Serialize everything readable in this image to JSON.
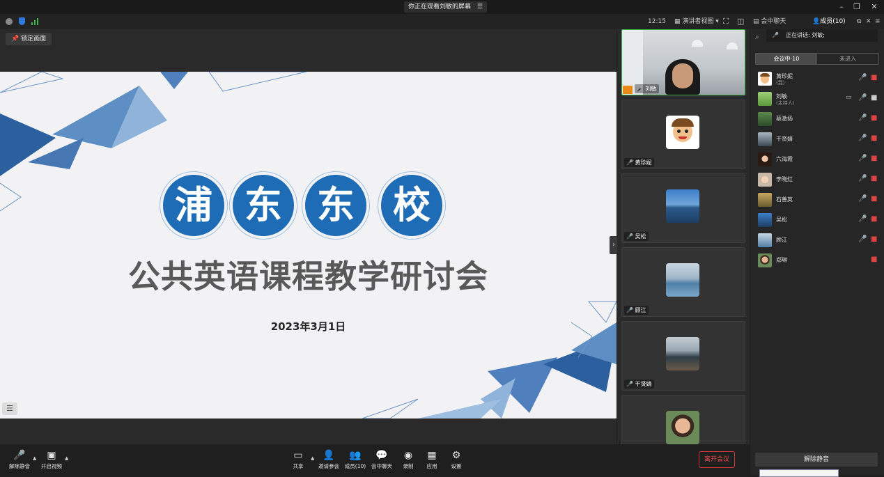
{
  "window": {
    "share_title": "你正在观看刘敏的屏幕",
    "share_icon": "menu-icon"
  },
  "topbar2": {
    "time": "12:15",
    "view_label": "演讲者视图",
    "chat_tab": "会中聊天",
    "members_tab": "成员(10)"
  },
  "stage": {
    "pin_label": "锁定画面"
  },
  "slide": {
    "circle_chars": [
      "浦",
      "东",
      "东",
      "校"
    ],
    "headline": "公共英语课程教学研讨会",
    "date": "2023年3月1日",
    "accent_color": "#1d6cb5"
  },
  "video_tiles": [
    {
      "name": "刘敏"
    },
    {
      "name": "黄珍妮"
    },
    {
      "name": "吴松"
    },
    {
      "name": "顾江"
    },
    {
      "name": "干贤婧"
    },
    {
      "name": ""
    }
  ],
  "panel": {
    "speaking": "正在讲话: 刘敏;",
    "tab_in_meeting": "会议中·10",
    "tab_not_joined": "未进入",
    "unmute_all": "解除静音",
    "participants": [
      {
        "name": "黄珍妮",
        "sub": "(我)"
      },
      {
        "name": "刘敏",
        "sub": "(主持人)"
      },
      {
        "name": "蔡激扬",
        "sub": ""
      },
      {
        "name": "干贤婧",
        "sub": ""
      },
      {
        "name": "六海霞",
        "sub": ""
      },
      {
        "name": "李晓红",
        "sub": ""
      },
      {
        "name": "石善英",
        "sub": ""
      },
      {
        "name": "吴松",
        "sub": ""
      },
      {
        "name": "顾江",
        "sub": ""
      },
      {
        "name": "郑琳",
        "sub": ""
      }
    ]
  },
  "toolbar": {
    "unmute": "解除静音",
    "video": "开启视频",
    "share": "共享",
    "invite": "邀请参会",
    "members": "成员(10)",
    "chat": "会中聊天",
    "record": "录制",
    "apps": "应用",
    "settings": "设置",
    "leave": "离开会议"
  }
}
